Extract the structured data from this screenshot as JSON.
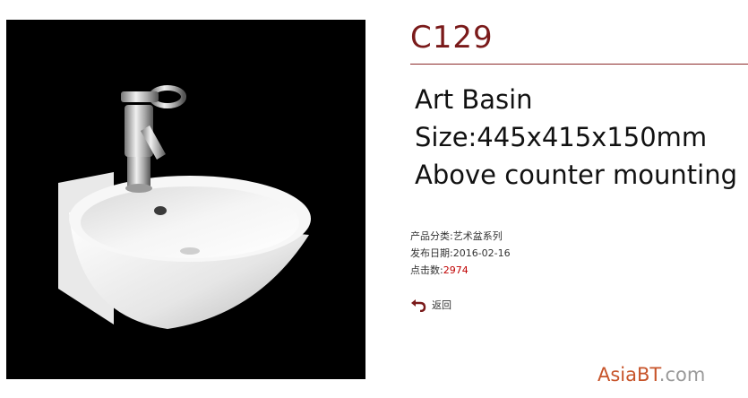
{
  "product": {
    "code": "C129",
    "name": "Art Basin",
    "size": "Size:445x415x150mm",
    "mounting": "Above counter mounting"
  },
  "meta": {
    "category_label": "产品分类:",
    "category_value": "艺术盆系列",
    "date_label": "发布日期:",
    "date_value": "2016-02-16",
    "hits_label": "点击数:",
    "hits_value": "2974"
  },
  "nav": {
    "back_label": "返回",
    "back_icon": "return-arrow-icon"
  },
  "watermark": {
    "brand": "AsiaBT",
    "suffix": ".com"
  },
  "colors": {
    "title": "#7a1a1a",
    "rule": "#8b2a2a",
    "hits": "#c00000",
    "watermark_brand": "#c7542a",
    "watermark_suffix": "#9a9a9a"
  }
}
